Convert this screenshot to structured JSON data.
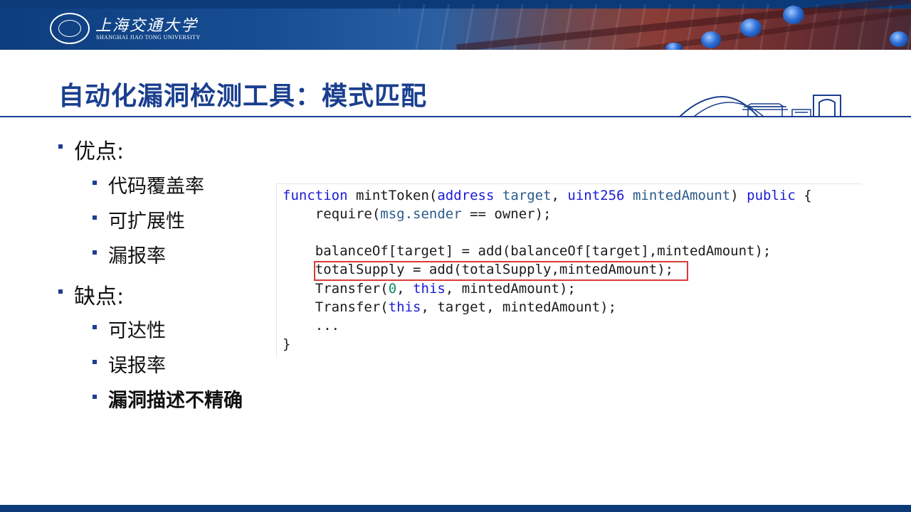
{
  "header": {
    "university_cn": "上海交通大学",
    "university_en": "SHANGHAI JIAO TONG UNIVERSITY",
    "colors": {
      "primary": "#1a3f8f",
      "banner": "#0c3a78"
    }
  },
  "slide": {
    "title": "自动化漏洞检测工具：模式匹配",
    "sections": [
      {
        "heading": "优点:",
        "items": [
          "代码覆盖率",
          "可扩展性",
          "漏报率"
        ]
      },
      {
        "heading": "缺点:",
        "items": [
          "可达性",
          "误报率",
          "漏洞描述不精确"
        ]
      }
    ]
  },
  "code": {
    "lines": [
      "function mintToken(address target, uint256 mintedAmount) public {",
      "    require(msg.sender == owner);",
      "",
      "    balanceOf[target] = add(balanceOf[target],mintedAmount);",
      "    totalSupply = add(totalSupply,mintedAmount);",
      "    Transfer(0, this, mintedAmount);",
      "    Transfer(this, target, mintedAmount);",
      "    ...",
      "}"
    ],
    "highlight_line_index": 4,
    "highlight_color": "#d83b3b"
  }
}
